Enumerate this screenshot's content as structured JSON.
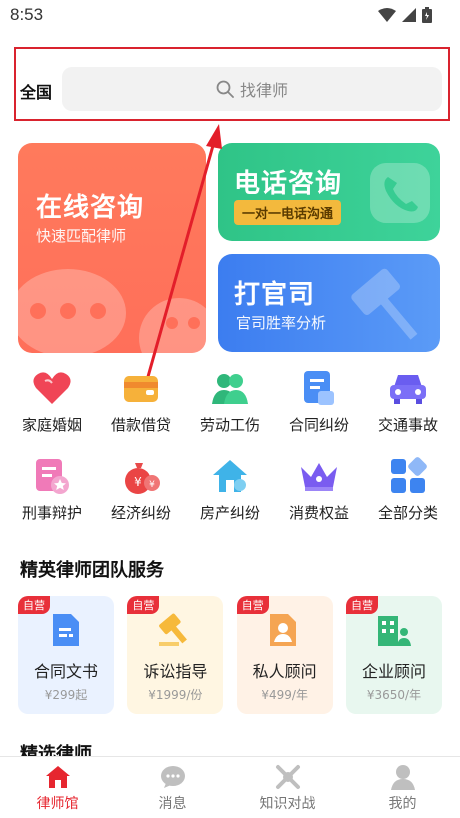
{
  "status_bar": {
    "time": "8:53"
  },
  "search": {
    "region": "全国",
    "placeholder": "找律师"
  },
  "cards": {
    "online": {
      "title": "在线咨询",
      "subtitle": "快速匹配律师"
    },
    "phone": {
      "title": "电话咨询",
      "tag": "一对一电话沟通"
    },
    "lawsuit": {
      "title": "打官司",
      "subtitle": "官司胜率分析"
    }
  },
  "categories": [
    {
      "label": "家庭婚姻",
      "icon": "heart-icon"
    },
    {
      "label": "借款借贷",
      "icon": "wallet-icon"
    },
    {
      "label": "劳动工伤",
      "icon": "workers-icon"
    },
    {
      "label": "合同纠纷",
      "icon": "contract-icon"
    },
    {
      "label": "交通事故",
      "icon": "car-icon"
    },
    {
      "label": "刑事辩护",
      "icon": "document-star-icon"
    },
    {
      "label": "经济纠纷",
      "icon": "money-bag-icon"
    },
    {
      "label": "房产纠纷",
      "icon": "house-icon"
    },
    {
      "label": "消费权益",
      "icon": "crown-icon"
    },
    {
      "label": "全部分类",
      "icon": "grid-icon"
    }
  ],
  "section": {
    "title": "精英律师团队服务"
  },
  "services": [
    {
      "badge": "自营",
      "name": "合同文书",
      "price": "¥299起",
      "bg": "#eaf2ff",
      "icon": "doc-icon"
    },
    {
      "badge": "自营",
      "name": "诉讼指导",
      "price": "¥1999/份",
      "bg": "#fff6e2",
      "icon": "gavel-icon"
    },
    {
      "badge": "自营",
      "name": "私人顾问",
      "price": "¥499/年",
      "bg": "#fff2e6",
      "icon": "person-doc-icon"
    },
    {
      "badge": "自营",
      "name": "企业顾问",
      "price": "¥3650/年",
      "bg": "#e8f7ef",
      "icon": "building-icon"
    }
  ],
  "section2": {
    "title": "精选律师"
  },
  "nav": [
    {
      "label": "律师馆",
      "active": true
    },
    {
      "label": "消息",
      "active": false
    },
    {
      "label": "知识对战",
      "active": false
    },
    {
      "label": "我的",
      "active": false
    }
  ],
  "colors": {
    "accent": "#e6262f",
    "annotation": "#d9232e"
  }
}
